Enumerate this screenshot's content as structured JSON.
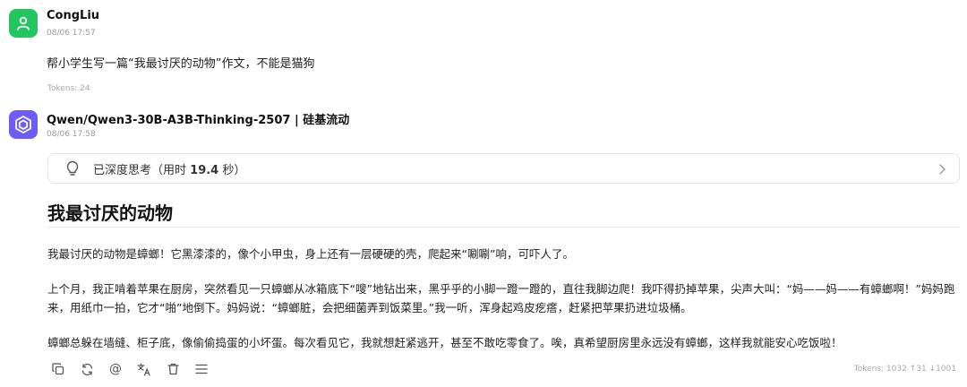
{
  "messages": [
    {
      "role": "user",
      "name": "CongLiu",
      "time": "08/06 17:57",
      "text": "帮小学生写一篇“我最讨厌的动物”作文，不能是猫狗",
      "tokens": "Tokens: 24"
    },
    {
      "role": "assistant",
      "name": "Qwen/Qwen3-30B-A3B-Thinking-2507 | 硅基流动",
      "time": "08/06 17:58",
      "thinking": {
        "label_prefix": "已深度思考（用时",
        "duration": "19.4",
        "label_suffix": "秒）"
      },
      "title": "我最讨厌的动物",
      "paragraphs": [
        "我最讨厌的动物是蟑螂！它黑漆漆的，像个小甲虫，身上还有一层硬硬的壳，爬起来“唰唰”响，可吓人了。",
        "上个月，我正啃着苹果在厨房，突然看见一只蟑螂从冰箱底下“嗖”地钻出来，黑乎乎的小脚一蹬一蹬的，直往我脚边爬！我吓得扔掉苹果，尖声大叫：“妈——妈——有蟑螂啊！”妈妈跑来，用纸巾一拍，它才“啪”地倒下。妈妈说：“蟑螂脏，会把细菌弄到饭菜里。”我一听，浑身起鸡皮疙瘩，赶紧把苹果扔进垃圾桶。",
        "蟑螂总躲在墙缝、柜子底，像偷偷捣蛋的小坏蛋。每次看见它，我就想赶紧逃开，甚至不敢吃零食了。唉，真希望厨房里永远没有蟑螂，这样我就能安心吃饭啦！"
      ],
      "tokens": "Tokens: 1032 ↑31 ↓1001",
      "toolbar": [
        "copy-icon",
        "regenerate-icon",
        "mention-icon",
        "translate-icon",
        "delete-icon",
        "menu-icon"
      ],
      "mention_glyph": "@"
    }
  ],
  "colors": {
    "user_avatar": "#22c55e",
    "bot_avatar": "#6d5df6"
  }
}
